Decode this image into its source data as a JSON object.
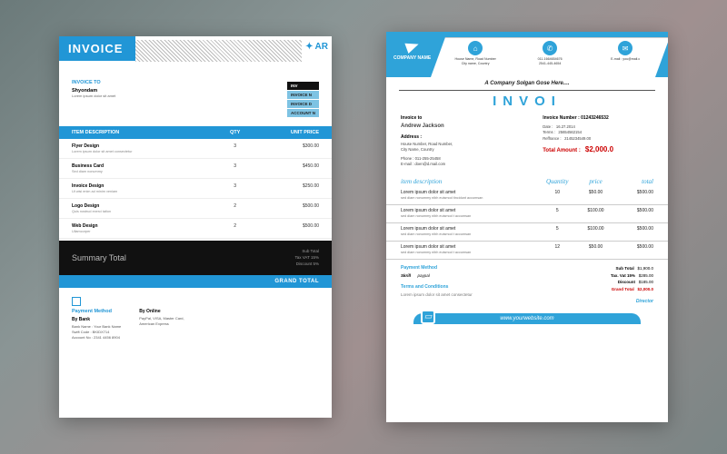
{
  "invoice1": {
    "title": "INVOICE",
    "logo_text": "AR",
    "invoice_to_label": "INVOICE TO",
    "client_name": "Shyondam",
    "client_sub": "Lorem ipsum dolor sit amet",
    "right_chips": {
      "inv": "INV",
      "invno": "INVOICE N",
      "invdate": "INVOICE D",
      "account": "ACCOUNT N"
    },
    "thead": {
      "desc": "ITEM DESCRIPTION",
      "qty": "QTY",
      "price": "UNIT PRICE"
    },
    "items": [
      {
        "name": "Flyer Design",
        "sub": "Lorem ipsum dolor sit amet consectetur",
        "qty": "3",
        "price": "$300.00"
      },
      {
        "name": "Business Card",
        "sub": "Sed diam nonummy",
        "qty": "3",
        "price": "$450.00"
      },
      {
        "name": "Invoice Design",
        "sub": "Ut wisi enim ad minim veniam",
        "qty": "3",
        "price": "$250.00"
      },
      {
        "name": "Logo Design",
        "sub": "Quis nostrud exerci tation",
        "qty": "2",
        "price": "$500.00"
      },
      {
        "name": "Web Design",
        "sub": "Ullamcorper",
        "qty": "2",
        "price": "$500.00"
      }
    ],
    "summary_label": "Summary Total",
    "summary_lines": {
      "sub": "Sub Total",
      "tax": "Tax VAT 15%",
      "disc": "Discount 5%"
    },
    "grand": "GRAND TOTAL",
    "payment": {
      "title": "Payment Method",
      "bank_hd": "By Bank",
      "bank_lines": "Bank Name : Your Bank Name\nSwift Code : BKIDX714\nAccount No : 2341 4456 8904",
      "online_hd": "By Online",
      "online_lines": "PayPal, VISA, Master Card,\nAmerican Express"
    }
  },
  "invoice2": {
    "company_name": "COMPANY NAME",
    "info": {
      "addr": "House Name, Road Number\nCity name, Country",
      "phone": "011-1664654676\n2541-445-4654",
      "email": "E-mail : you@mail.c"
    },
    "slogan": "A Company Solgan Gose  Here....",
    "title": "INVOI",
    "left": {
      "to_lbl": "Invoice to",
      "to_name": "Andrew Jackson",
      "addr_lbl": "Address :",
      "addr": "House Number, Road Number,\nCity Name, Country",
      "phone": "Phone : 011-255-25458",
      "email": "E-mail : doen@d.mail.com"
    },
    "right": {
      "num_lbl": "Invoice Number : 01243246532",
      "date_lbl": "Date :",
      "date": "16.27.2014",
      "terms_lbl": "Terms :",
      "terms": "25654562154",
      "ref_lbl": "Reffrance :",
      "ref": "2145234549.00",
      "total_lbl": "Total Amount   :",
      "total_val": "$2,000.0"
    },
    "thead": {
      "desc": "item description",
      "qty": "Quantity",
      "price": "price",
      "total": "total"
    },
    "items": [
      {
        "name": "Lorem ipsum dolor sit amet",
        "sub": "sed diam nonummy nibh euismod tincidunt accumsan",
        "qty": "10",
        "price": "$50.00",
        "total": "$500.00"
      },
      {
        "name": "Lorem ipsum dolor sit amet",
        "sub": "sed diam nonummy nibh euismod t accumsan",
        "qty": "5",
        "price": "$100.00",
        "total": "$500.00"
      },
      {
        "name": "Lorem ipsum dolor sit amet",
        "sub": "sed diam nonummy nibh euismod t accumsan",
        "qty": "5",
        "price": "$100.00",
        "total": "$500.00"
      },
      {
        "name": "Lorem ipsum dolor sit amet",
        "sub": "sed diam nonummy nibh euismod t accumsan",
        "qty": "12",
        "price": "$50.00",
        "total": "$500.00"
      }
    ],
    "payment": {
      "hd": "Payment Method",
      "a": "Skrill",
      "b": "paypal"
    },
    "terms_hd": "Terms and Conditions",
    "terms_txt": "Lorem ipsum dolor sit amet consectetur",
    "totals": {
      "sub_lbl": "Sub Total",
      "sub": "$1,900.0",
      "tax_lbl": "Tax. Vat 15%",
      "tax": "$285.00",
      "disc_lbl": "Discount",
      "disc": "$185.00",
      "grand_lbl": "Grand Total",
      "grand": "$2,000.0",
      "sig": "Director"
    },
    "footer": "www.yourwebsite.com"
  }
}
